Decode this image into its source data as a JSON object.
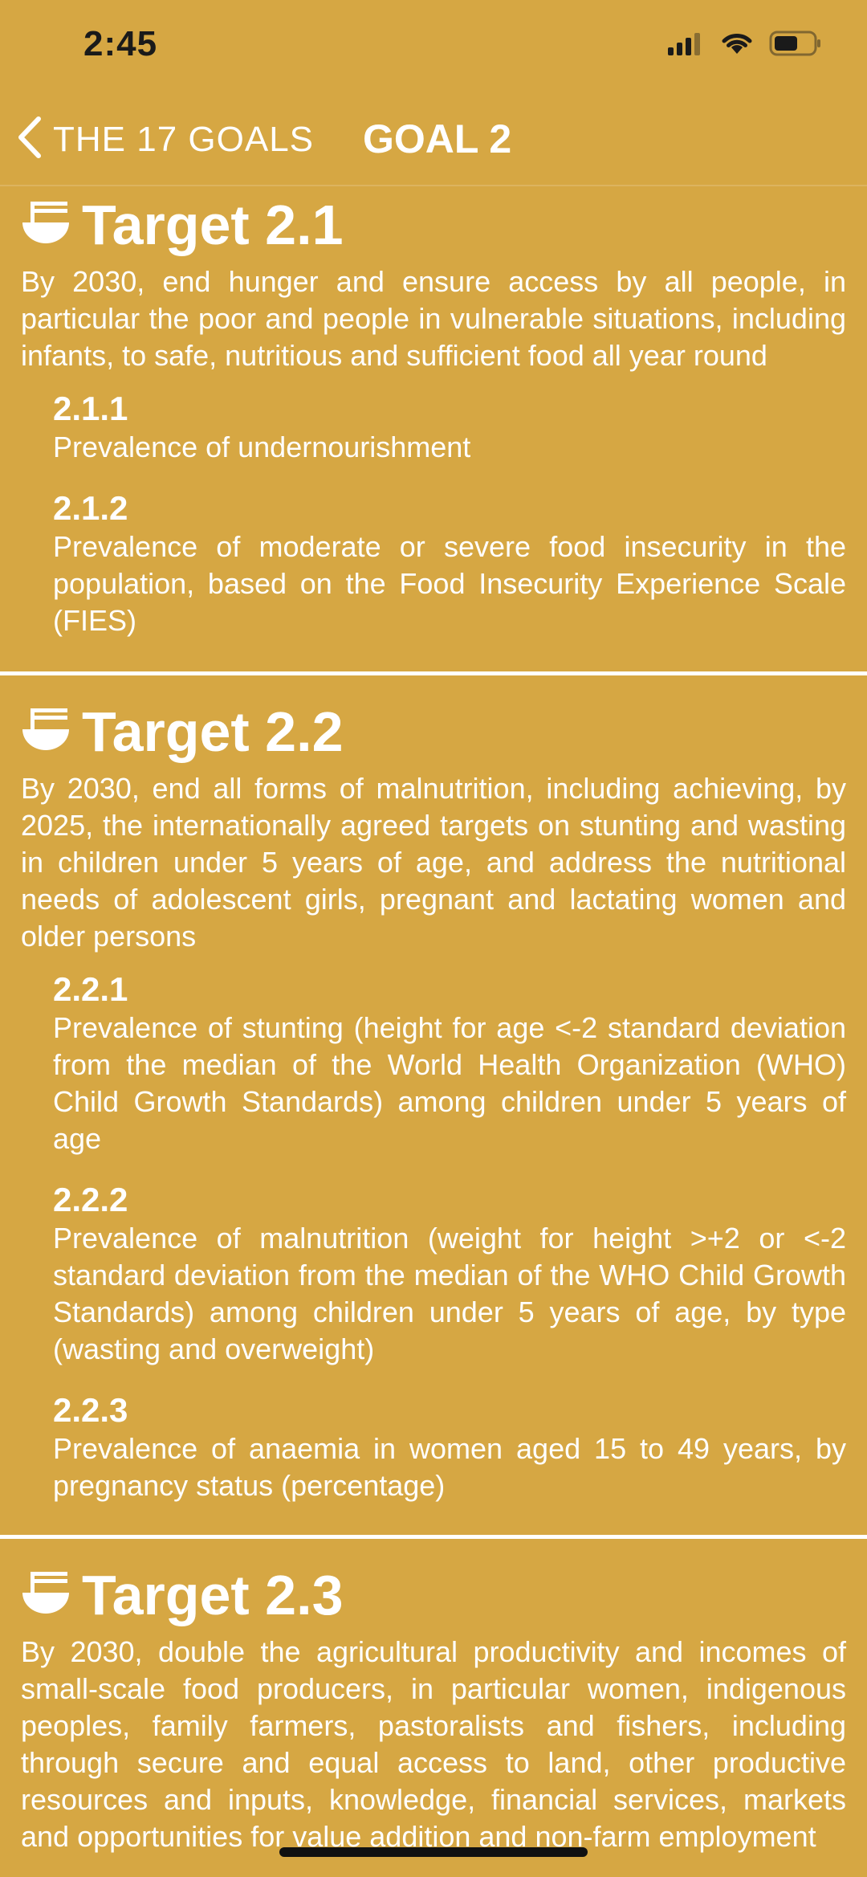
{
  "status_bar": {
    "time": "2:45",
    "icons": [
      "cellular-signal-icon",
      "wifi-icon",
      "battery-icon"
    ]
  },
  "nav": {
    "back_label": "THE 17 GOALS",
    "title": "GOAL 2"
  },
  "colors": {
    "background": "#D6A743",
    "text": "#FFFFFF"
  },
  "targets": [
    {
      "icon": "bowl-icon",
      "title": "Target 2.1",
      "text": "By 2030, end hunger and ensure access by all people, in particular the poor and people in vulnerable situations, including infants, to safe, nutritious and sufficient food all year round",
      "indicators": [
        {
          "code": "2.1.1",
          "text": "Prevalence of undernourishment"
        },
        {
          "code": "2.1.2",
          "text": "Prevalence of moderate or severe food insecurity in the population, based on the Food Insecurity Experience Scale (FIES)"
        }
      ]
    },
    {
      "icon": "bowl-icon",
      "title": "Target 2.2",
      "text": "By 2030, end all forms of malnutrition, including achieving, by 2025, the internationally agreed targets on stunting and wasting in children under 5 years of age, and address the nutritional needs of adolescent girls, pregnant and lactating women and older persons",
      "indicators": [
        {
          "code": "2.2.1",
          "text": "Prevalence of stunting (height for age <-2 standard deviation from the median of the World Health Organization (WHO) Child Growth Standards) among children under 5 years of age"
        },
        {
          "code": "2.2.2",
          "text": "Prevalence of malnutrition (weight for height >+2 or <-2 standard deviation from the median of the WHO Child Growth Standards) among children under 5 years of age, by type (wasting and overweight)"
        },
        {
          "code": "2.2.3",
          "text": "Prevalence of anaemia in women aged 15 to 49 years, by pregnancy status (percentage)"
        }
      ]
    },
    {
      "icon": "bowl-icon",
      "title": "Target 2.3",
      "text": "By 2030, double the agricultural productivity and incomes of small-scale food producers, in particular women, indigenous peoples, family farmers, pastoralists and fishers, including through secure and equal access to land, other productive resources and inputs, knowledge, financial services, markets and opportunities for value addition and non-farm employment",
      "indicators": []
    }
  ]
}
